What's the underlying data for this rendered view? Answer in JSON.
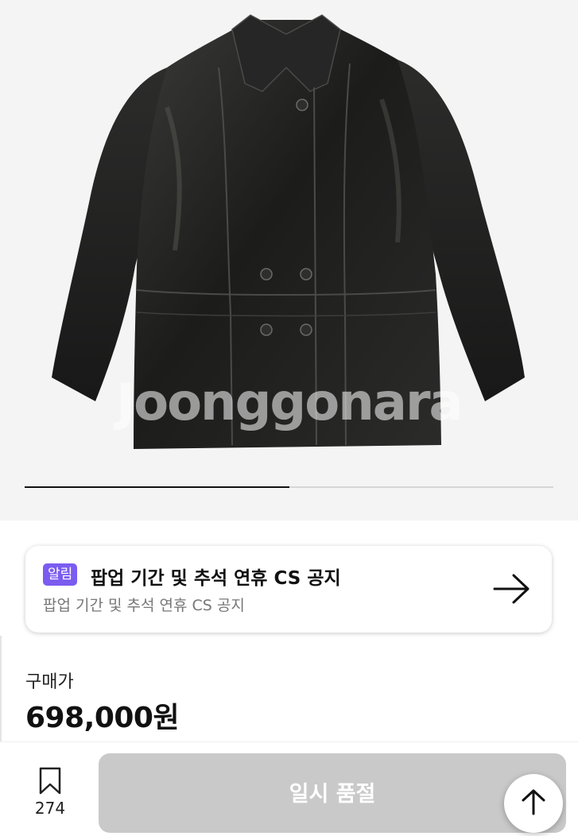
{
  "product": {
    "image_alt": "black leather double-breasted jacket",
    "watermark": "Joonggonara"
  },
  "carousel": {
    "current": 1,
    "total": 2
  },
  "notice": {
    "badge": "알림",
    "title": "팝업 기간 및 추석 연휴 CS 공지",
    "subtitle": "팝업 기간 및 추석 연휴 CS 공지",
    "arrow_icon": "arrow-right-icon"
  },
  "price": {
    "label": "구매가",
    "value": "698,000원"
  },
  "bottom_bar": {
    "bookmark_icon": "bookmark-icon",
    "bookmark_count": "274",
    "action_label": "일시 품절",
    "scroll_top_icon": "arrow-up-icon"
  },
  "colors": {
    "hero_bg": "#f4f4f4",
    "badge": "#7b5cf0",
    "button_disabled": "#c9c9c9",
    "text_primary": "#111111",
    "text_secondary": "#777777"
  }
}
